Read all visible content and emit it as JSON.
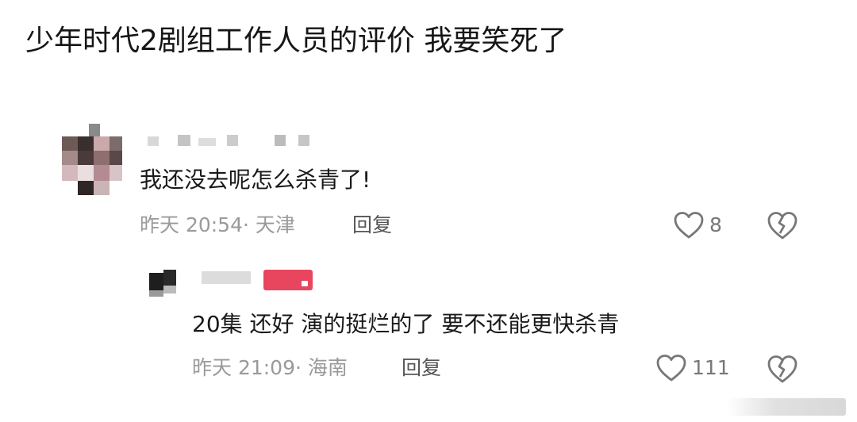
{
  "post": {
    "title": "少年时代2剧组工作人员的评价 我要笑死了"
  },
  "comments": [
    {
      "text": "我还没去呢怎么杀青了!",
      "time": "昨天 20:54",
      "location": "· 天津",
      "reply_label": "回复",
      "likes": "8",
      "like_icon": "heart-outline-icon",
      "dislike_icon": "broken-heart-icon"
    },
    {
      "text": "20集 还好 演的挺烂的了 要不还能更快杀青",
      "time": "昨天 21:09",
      "location": "· 海南",
      "reply_label": "回复",
      "likes": "111",
      "like_icon": "heart-outline-icon",
      "dislike_icon": "broken-heart-icon"
    }
  ],
  "colors": {
    "text_primary": "#1a1a1a",
    "text_meta": "#9a9a9a",
    "icon": "#777777",
    "reply_badge": "#e8455f"
  }
}
